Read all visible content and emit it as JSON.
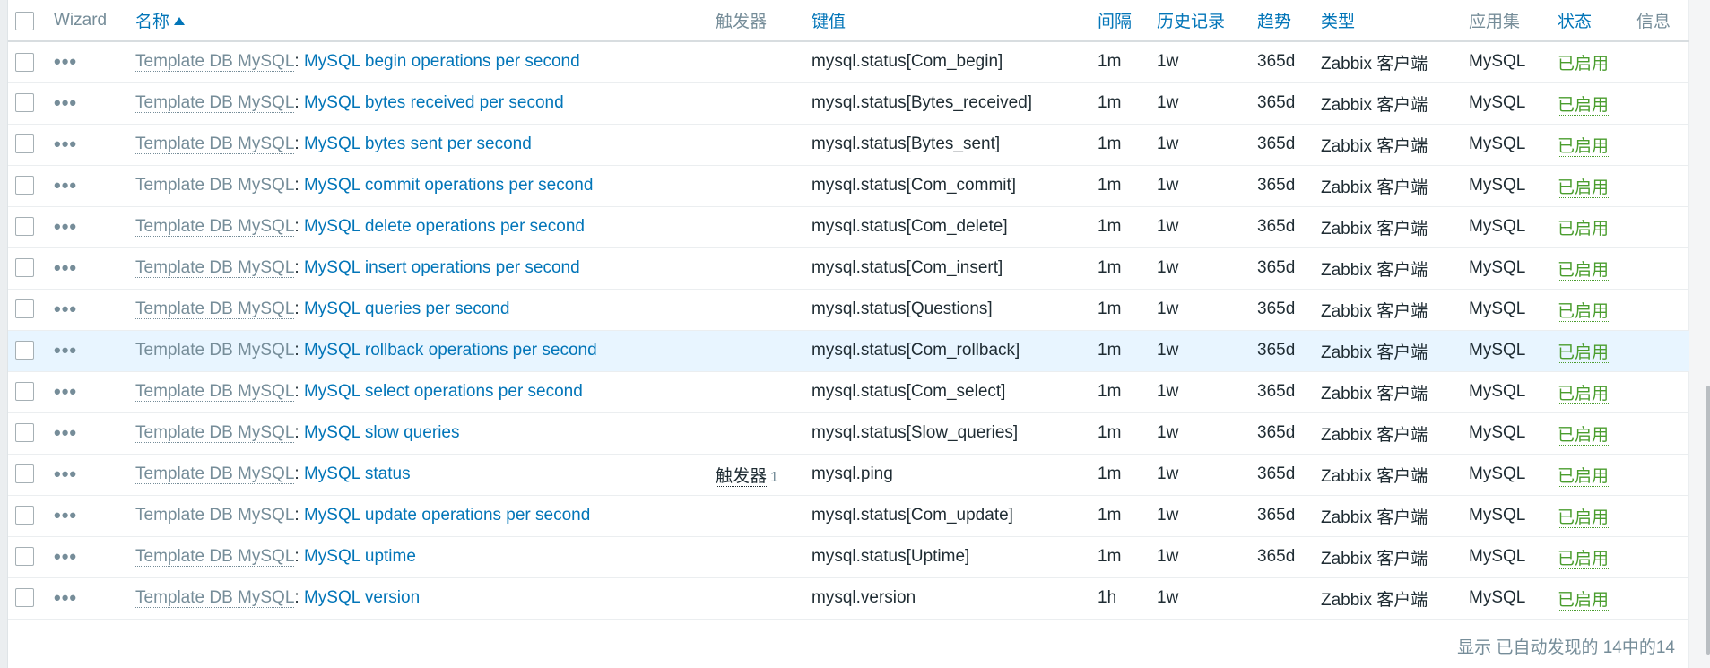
{
  "header": {
    "wizard": "Wizard",
    "name": "名称",
    "triggers": "触发器",
    "key": "键值",
    "interval": "间隔",
    "history": "历史记录",
    "trends": "趋势",
    "type": "类型",
    "applications": "应用集",
    "status": "状态",
    "info": "信息"
  },
  "template_name": "Template DB MySQL",
  "separator": ":",
  "rows": [
    {
      "name": "MySQL begin operations per second",
      "triggers": "",
      "trig_count": "",
      "key": "mysql.status[Com_begin]",
      "interval": "1m",
      "history": "1w",
      "trends": "365d",
      "type": "Zabbix 客户端",
      "app": "MySQL",
      "status": "已启用"
    },
    {
      "name": "MySQL bytes received per second",
      "triggers": "",
      "trig_count": "",
      "key": "mysql.status[Bytes_received]",
      "interval": "1m",
      "history": "1w",
      "trends": "365d",
      "type": "Zabbix 客户端",
      "app": "MySQL",
      "status": "已启用"
    },
    {
      "name": "MySQL bytes sent per second",
      "triggers": "",
      "trig_count": "",
      "key": "mysql.status[Bytes_sent]",
      "interval": "1m",
      "history": "1w",
      "trends": "365d",
      "type": "Zabbix 客户端",
      "app": "MySQL",
      "status": "已启用"
    },
    {
      "name": "MySQL commit operations per second",
      "triggers": "",
      "trig_count": "",
      "key": "mysql.status[Com_commit]",
      "interval": "1m",
      "history": "1w",
      "trends": "365d",
      "type": "Zabbix 客户端",
      "app": "MySQL",
      "status": "已启用"
    },
    {
      "name": "MySQL delete operations per second",
      "triggers": "",
      "trig_count": "",
      "key": "mysql.status[Com_delete]",
      "interval": "1m",
      "history": "1w",
      "trends": "365d",
      "type": "Zabbix 客户端",
      "app": "MySQL",
      "status": "已启用"
    },
    {
      "name": "MySQL insert operations per second",
      "triggers": "",
      "trig_count": "",
      "key": "mysql.status[Com_insert]",
      "interval": "1m",
      "history": "1w",
      "trends": "365d",
      "type": "Zabbix 客户端",
      "app": "MySQL",
      "status": "已启用"
    },
    {
      "name": "MySQL queries per second",
      "triggers": "",
      "trig_count": "",
      "key": "mysql.status[Questions]",
      "interval": "1m",
      "history": "1w",
      "trends": "365d",
      "type": "Zabbix 客户端",
      "app": "MySQL",
      "status": "已启用"
    },
    {
      "name": "MySQL rollback operations per second",
      "triggers": "",
      "trig_count": "",
      "key": "mysql.status[Com_rollback]",
      "interval": "1m",
      "history": "1w",
      "trends": "365d",
      "type": "Zabbix 客户端",
      "app": "MySQL",
      "status": "已启用"
    },
    {
      "name": "MySQL select operations per second",
      "triggers": "",
      "trig_count": "",
      "key": "mysql.status[Com_select]",
      "interval": "1m",
      "history": "1w",
      "trends": "365d",
      "type": "Zabbix 客户端",
      "app": "MySQL",
      "status": "已启用"
    },
    {
      "name": "MySQL slow queries",
      "triggers": "",
      "trig_count": "",
      "key": "mysql.status[Slow_queries]",
      "interval": "1m",
      "history": "1w",
      "trends": "365d",
      "type": "Zabbix 客户端",
      "app": "MySQL",
      "status": "已启用"
    },
    {
      "name": "MySQL status",
      "triggers": "触发器",
      "trig_count": "1",
      "key": "mysql.ping",
      "interval": "1m",
      "history": "1w",
      "trends": "365d",
      "type": "Zabbix 客户端",
      "app": "MySQL",
      "status": "已启用"
    },
    {
      "name": "MySQL update operations per second",
      "triggers": "",
      "trig_count": "",
      "key": "mysql.status[Com_update]",
      "interval": "1m",
      "history": "1w",
      "trends": "365d",
      "type": "Zabbix 客户端",
      "app": "MySQL",
      "status": "已启用"
    },
    {
      "name": "MySQL uptime",
      "triggers": "",
      "trig_count": "",
      "key": "mysql.status[Uptime]",
      "interval": "1m",
      "history": "1w",
      "trends": "365d",
      "type": "Zabbix 客户端",
      "app": "MySQL",
      "status": "已启用"
    },
    {
      "name": "MySQL version",
      "triggers": "",
      "trig_count": "",
      "key": "mysql.version",
      "interval": "1h",
      "history": "1w",
      "trends": "",
      "type": "Zabbix 客户端",
      "app": "MySQL",
      "status": "已启用"
    }
  ],
  "hover_row_index": 7,
  "footer": "显示 已自动发现的 14中的14",
  "colors": {
    "link": "#0275b8",
    "muted": "#768d99",
    "enabled": "#4a9d2e",
    "hover_row": "#e8f5ff"
  }
}
